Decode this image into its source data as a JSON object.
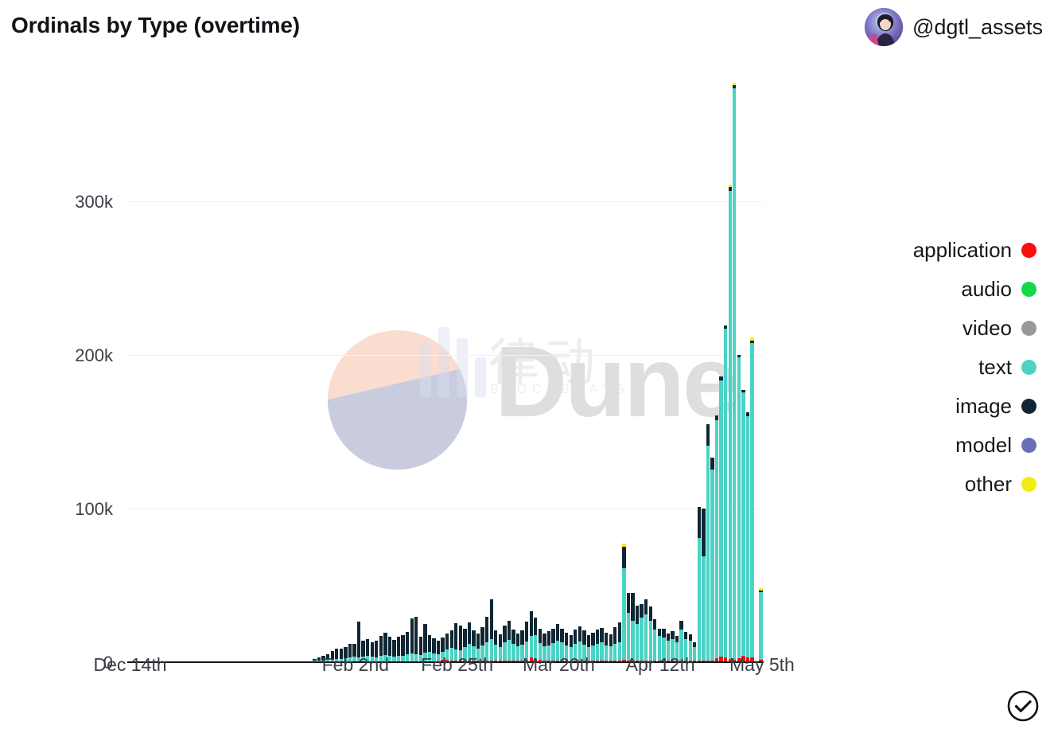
{
  "header": {
    "title": "Ordinals by Type (overtime)",
    "user_handle": "@dgtl_assets",
    "avatar_name": "user-avatar"
  },
  "legend": {
    "position": "right",
    "items": [
      {
        "label": "application",
        "color": "#fa0f0c"
      },
      {
        "label": "audio",
        "color": "#13d94a"
      },
      {
        "label": "video",
        "color": "#97999b"
      },
      {
        "label": "text",
        "color": "#4bd3c6"
      },
      {
        "label": "image",
        "color": "#102733"
      },
      {
        "label": "model",
        "color": "#6b6fb5"
      },
      {
        "label": "other",
        "color": "#f2ec15"
      }
    ]
  },
  "watermark": {
    "brand": "Dune",
    "cn_text": "律动",
    "cn_sub": "BLOCKBEATS"
  },
  "footer": {
    "verified_icon": "check-circle-icon"
  },
  "chart_data": {
    "type": "bar",
    "stacked": true,
    "title": "Ordinals by Type (overtime)",
    "xlabel": "",
    "ylabel": "",
    "ylim": [
      0,
      380000
    ],
    "grid": true,
    "legend_position": "right",
    "ytick_labels": [
      "0",
      "100k",
      "200k",
      "300k"
    ],
    "ytick_values": [
      0,
      100000,
      200000,
      300000
    ],
    "xtick_labels": [
      "Dec 14th",
      "Feb 2nd",
      "Feb 25th",
      "Mar 20th",
      "Apr 12th",
      "May 5th"
    ],
    "xtick_indices": [
      0,
      51,
      74,
      97,
      120,
      143
    ],
    "series_order": [
      "application",
      "audio",
      "video",
      "text",
      "image",
      "model",
      "other"
    ],
    "series_colors": {
      "application": "#fa0f0c",
      "audio": "#13d94a",
      "video": "#97999b",
      "text": "#4bd3c6",
      "image": "#102733",
      "model": "#6b6fb5",
      "other": "#f2ec15"
    },
    "bar_count": 144,
    "series": [
      {
        "name": "text",
        "values": [
          0,
          0,
          0,
          0,
          0,
          0,
          0,
          0,
          0,
          0,
          0,
          0,
          0,
          0,
          0,
          0,
          0,
          0,
          0,
          0,
          0,
          0,
          0,
          0,
          0,
          0,
          0,
          0,
          0,
          0,
          0,
          0,
          0,
          0,
          0,
          0,
          0,
          0,
          0,
          0,
          0,
          0,
          300,
          500,
          700,
          900,
          1200,
          1500,
          1800,
          2000,
          2500,
          3000,
          2800,
          3200,
          3500,
          3000,
          2600,
          3800,
          4200,
          3600,
          3000,
          3400,
          3800,
          4500,
          5200,
          4800,
          4200,
          5600,
          6000,
          5200,
          4600,
          5000,
          7000,
          8000,
          7500,
          6800,
          9000,
          11000,
          9500,
          8000,
          10000,
          12000,
          14000,
          10500,
          9000,
          12000,
          13500,
          11000,
          9500,
          10500,
          12500,
          14000,
          15500,
          11000,
          9500,
          10000,
          11500,
          13000,
          12000,
          10000,
          9000,
          11000,
          12500,
          10500,
          9000,
          10000,
          11000,
          12000,
          10000,
          9500,
          11000,
          12000,
          60000,
          31000,
          26000,
          24000,
          28000,
          30000,
          26000,
          20000,
          16000,
          15000,
          13000,
          14000,
          12000,
          20000,
          14000,
          13000,
          9000,
          80000,
          68000,
          140000,
          124000,
          155000,
          180000,
          214000,
          305000,
          372000,
          196000,
          172000,
          157000,
          205000,
          0,
          44000
        ]
      },
      {
        "name": "image",
        "values": [
          0,
          0,
          0,
          0,
          0,
          0,
          0,
          0,
          0,
          0,
          0,
          0,
          0,
          0,
          0,
          0,
          0,
          0,
          0,
          0,
          0,
          0,
          0,
          0,
          0,
          0,
          0,
          0,
          0,
          0,
          0,
          0,
          0,
          0,
          0,
          0,
          0,
          0,
          0,
          0,
          0,
          0,
          1200,
          2200,
          3000,
          4000,
          5500,
          7000,
          6500,
          7500,
          9000,
          8500,
          23000,
          10500,
          11000,
          9500,
          11000,
          13000,
          14500,
          12500,
          11000,
          12500,
          13500,
          14500,
          23000,
          24000,
          12000,
          19000,
          11000,
          10000,
          9000,
          9500,
          10000,
          11500,
          17000,
          16000,
          12000,
          14000,
          10000,
          9500,
          12000,
          16500,
          26000,
          9000,
          8000,
          11000,
          12500,
          9000,
          8000,
          9000,
          13000,
          16000,
          11000,
          9500,
          8000,
          9000,
          9500,
          11000,
          9000,
          8000,
          7500,
          9000,
          10000,
          9000,
          7500,
          8000,
          9000,
          9500,
          8000,
          7500,
          11000,
          13000,
          14000,
          13000,
          18000,
          12000,
          9000,
          10000,
          9500,
          7000,
          5000,
          5500,
          4500,
          5000,
          4000,
          6000,
          4500,
          4000,
          3000,
          20000,
          31000,
          14000,
          8000,
          3000,
          2500,
          2000,
          2500,
          2000,
          1500,
          1500,
          2500,
          1500,
          0,
          1500
        ]
      },
      {
        "name": "application",
        "values": [
          0,
          0,
          0,
          0,
          0,
          0,
          0,
          0,
          0,
          0,
          0,
          0,
          0,
          0,
          0,
          0,
          0,
          0,
          0,
          0,
          0,
          0,
          0,
          0,
          0,
          0,
          0,
          0,
          0,
          0,
          0,
          0,
          0,
          0,
          0,
          0,
          0,
          0,
          0,
          0,
          0,
          0,
          0,
          0,
          0,
          0,
          0,
          0,
          0,
          0,
          0,
          0,
          0,
          0,
          0,
          0,
          0,
          0,
          0,
          0,
          0,
          0,
          0,
          0,
          0,
          0,
          0,
          0,
          0,
          0,
          0,
          1200,
          900,
          600,
          400,
          300,
          200,
          200,
          300,
          200,
          200,
          200,
          200,
          200,
          200,
          200,
          200,
          200,
          200,
          200,
          200,
          2800,
          1800,
          900,
          400,
          300,
          300,
          300,
          300,
          300,
          300,
          300,
          300,
          300,
          300,
          300,
          300,
          300,
          300,
          300,
          300,
          300,
          800,
          500,
          400,
          400,
          400,
          400,
          400,
          400,
          400,
          400,
          400,
          400,
          400,
          400,
          400,
          400,
          400,
          400,
          500,
          600,
          700,
          2200,
          3000,
          2600,
          1400,
          1200,
          2200,
          3400,
          2600,
          2600,
          0,
          900
        ]
      },
      {
        "name": "model",
        "values": [
          0,
          0,
          0,
          0,
          0,
          0,
          0,
          0,
          0,
          0,
          0,
          0,
          0,
          0,
          0,
          0,
          0,
          0,
          0,
          0,
          0,
          0,
          0,
          0,
          0,
          0,
          0,
          0,
          0,
          0,
          0,
          0,
          0,
          0,
          0,
          0,
          0,
          0,
          0,
          0,
          0,
          0,
          0,
          0,
          0,
          0,
          0,
          0,
          0,
          0,
          0,
          0,
          0,
          0,
          0,
          0,
          0,
          0,
          0,
          0,
          0,
          0,
          0,
          0,
          0,
          0,
          0,
          0,
          0,
          0,
          0,
          0,
          0,
          0,
          0,
          0,
          0,
          0,
          0,
          0,
          0,
          0,
          0,
          0,
          0,
          0,
          0,
          0,
          0,
          0,
          0,
          0,
          0,
          0,
          0,
          0,
          0,
          0,
          0,
          0,
          0,
          0,
          0,
          0,
          0,
          0,
          0,
          0,
          0,
          0,
          0,
          0,
          0,
          0,
          0,
          0,
          0,
          0,
          0,
          0,
          0,
          0,
          0,
          0,
          0,
          0,
          0,
          0,
          0,
          0,
          0,
          0,
          0,
          0,
          0,
          0,
          0,
          0,
          0,
          0,
          0,
          0,
          0,
          0
        ]
      },
      {
        "name": "other",
        "values": [
          0,
          0,
          0,
          0,
          0,
          0,
          0,
          0,
          0,
          0,
          0,
          0,
          0,
          0,
          0,
          0,
          0,
          0,
          0,
          0,
          0,
          0,
          0,
          0,
          0,
          0,
          0,
          0,
          0,
          0,
          0,
          0,
          0,
          0,
          0,
          0,
          0,
          0,
          0,
          0,
          0,
          0,
          0,
          0,
          0,
          0,
          0,
          0,
          0,
          0,
          0,
          0,
          0,
          0,
          0,
          0,
          0,
          0,
          0,
          0,
          0,
          0,
          0,
          0,
          0,
          0,
          0,
          0,
          0,
          0,
          0,
          0,
          0,
          0,
          0,
          0,
          0,
          0,
          0,
          0,
          0,
          0,
          0,
          0,
          0,
          0,
          0,
          0,
          0,
          0,
          0,
          0,
          0,
          0,
          0,
          0,
          0,
          0,
          0,
          0,
          0,
          0,
          0,
          0,
          0,
          0,
          0,
          0,
          0,
          0,
          0,
          0,
          1800,
          0,
          0,
          0,
          0,
          0,
          0,
          0,
          0,
          0,
          0,
          0,
          0,
          0,
          0,
          0,
          0,
          0,
          0,
          0,
          0,
          0,
          0,
          0,
          1500,
          1500,
          0,
          0,
          0,
          1800,
          0,
          1500
        ]
      },
      {
        "name": "audio",
        "values": [
          0,
          0,
          0,
          0,
          0,
          0,
          0,
          0,
          0,
          0,
          0,
          0,
          0,
          0,
          0,
          0,
          0,
          0,
          0,
          0,
          0,
          0,
          0,
          0,
          0,
          0,
          0,
          0,
          0,
          0,
          0,
          0,
          0,
          0,
          0,
          0,
          0,
          0,
          0,
          0,
          0,
          0,
          0,
          0,
          0,
          0,
          0,
          0,
          0,
          0,
          0,
          0,
          0,
          0,
          0,
          0,
          0,
          0,
          0,
          0,
          0,
          0,
          0,
          0,
          0,
          0,
          0,
          0,
          0,
          0,
          0,
          0,
          0,
          0,
          0,
          0,
          0,
          0,
          0,
          0,
          0,
          0,
          0,
          0,
          0,
          0,
          0,
          0,
          0,
          0,
          0,
          0,
          0,
          0,
          0,
          0,
          0,
          0,
          0,
          0,
          0,
          0,
          0,
          0,
          0,
          0,
          0,
          0,
          0,
          0,
          0,
          0,
          0,
          0,
          0,
          0,
          0,
          0,
          0,
          0,
          0,
          0,
          0,
          0,
          0,
          0,
          0,
          0,
          0,
          0,
          0,
          0,
          0,
          0,
          0,
          0,
          0,
          0,
          0,
          0,
          0,
          0,
          0,
          0
        ]
      },
      {
        "name": "video",
        "values": [
          0,
          0,
          0,
          0,
          0,
          0,
          0,
          0,
          0,
          0,
          0,
          0,
          0,
          0,
          0,
          0,
          0,
          0,
          0,
          0,
          0,
          0,
          0,
          0,
          0,
          0,
          0,
          0,
          0,
          0,
          0,
          0,
          0,
          0,
          0,
          0,
          0,
          0,
          0,
          0,
          0,
          0,
          0,
          0,
          0,
          0,
          0,
          0,
          0,
          0,
          0,
          0,
          0,
          0,
          0,
          0,
          0,
          0,
          0,
          0,
          0,
          0,
          0,
          0,
          0,
          0,
          0,
          0,
          0,
          0,
          0,
          0,
          0,
          0,
          0,
          0,
          0,
          0,
          0,
          0,
          0,
          0,
          0,
          0,
          0,
          0,
          0,
          0,
          0,
          0,
          0,
          0,
          0,
          0,
          0,
          0,
          0,
          0,
          0,
          0,
          0,
          0,
          0,
          0,
          0,
          0,
          0,
          0,
          0,
          0,
          0,
          0,
          0,
          0,
          0,
          0,
          0,
          0,
          0,
          0,
          0,
          0,
          0,
          0,
          0,
          0,
          0,
          0,
          0,
          0,
          0,
          0,
          0,
          0,
          0,
          0,
          0,
          0,
          0,
          0,
          0,
          0,
          0,
          0
        ]
      }
    ]
  }
}
